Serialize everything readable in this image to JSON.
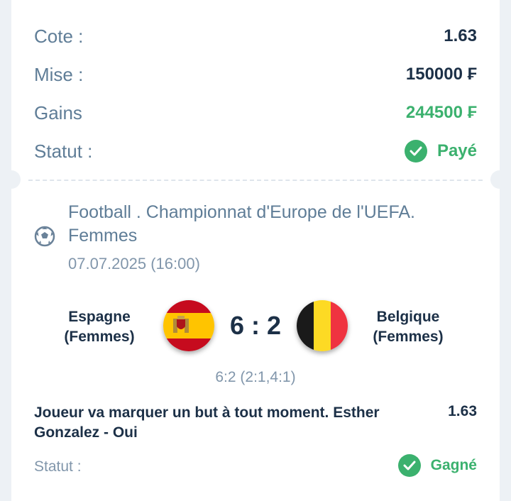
{
  "summary": {
    "odds_label": "Cote :",
    "odds_value": "1.63",
    "stake_label": "Mise :",
    "stake_value": "150000 ₣",
    "winnings_label": "Gains",
    "winnings_value": "244500 ₣",
    "status_label": "Statut :",
    "status_value": "Payé"
  },
  "event": {
    "league": "Football . Championnat d'Europe de l'UEFA. Femmes",
    "date": "07.07.2025 (16:00)",
    "home_team": "Espagne (Femmes)",
    "away_team": "Belgique (Femmes)",
    "score": "6 : 2",
    "score_detail": "6:2 (2:1,4:1)"
  },
  "selection": {
    "description": "Joueur va marquer un but à tout moment. Esther Gonzalez - Oui",
    "odds": "1.63",
    "status_label": "Statut :",
    "status_value": "Gagné"
  },
  "icons": {
    "sport": "soccer-ball-icon",
    "status": "check-circle-icon"
  },
  "colors": {
    "label": "#5f7d97",
    "value": "#1c3047",
    "success": "#3bb16e",
    "muted": "#8196ab"
  }
}
